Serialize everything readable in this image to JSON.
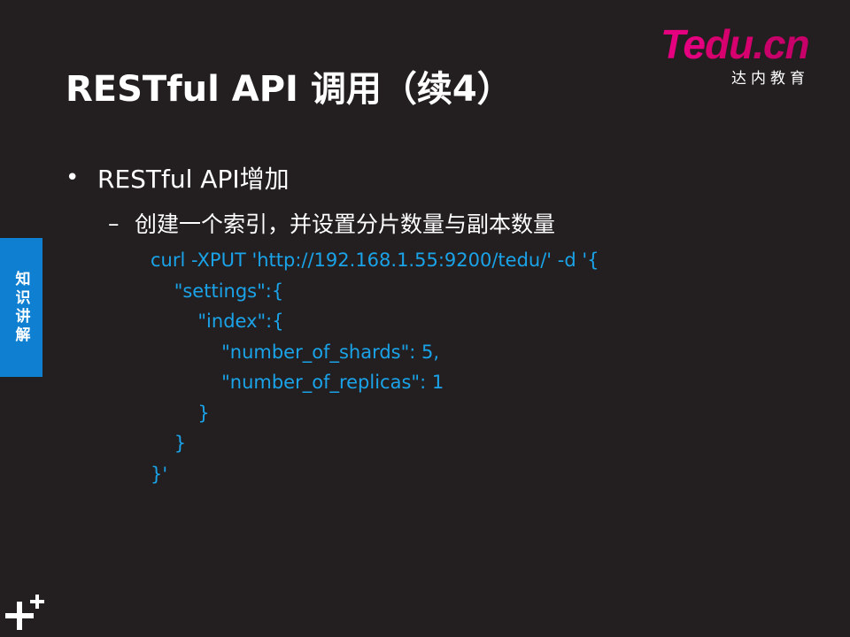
{
  "slide": {
    "title": "RESTful API 调用（续4）",
    "logo": {
      "brand_part1": "Te",
      "brand_part2": "du",
      "brand_part3": ".cn",
      "subtitle": "达内教育"
    },
    "side_tab": "知识讲解",
    "bullet_level1": "RESTful API增加",
    "bullet_level2": "创建一个索引，并设置分片数量与副本数量",
    "code_lines": [
      "curl -XPUT 'http://192.168.1.55:9200/tedu/' -d '{",
      "    \"settings\":{",
      "        \"index\":{",
      "            \"number_of_shards\": 5,",
      "            \"number_of_replicas\": 1",
      "        }",
      "    }",
      "}'"
    ],
    "colors": {
      "background": "#231f20",
      "accent_blue": "#0e7fd1",
      "code_text": "#1aa3e8",
      "brand_magenta": "#e4007f"
    },
    "icons": {
      "bottom_left": "plus-plus-icon"
    }
  }
}
